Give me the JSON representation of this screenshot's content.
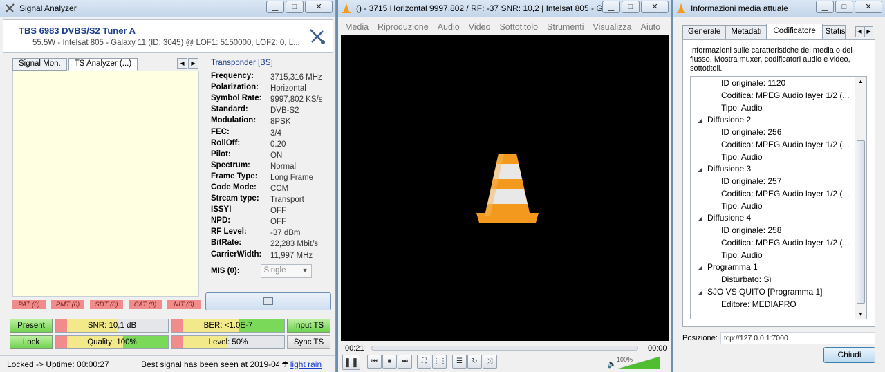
{
  "signal_analyzer": {
    "title": "Signal Analyzer",
    "tuner": "TBS 6983 DVBS/S2 Tuner A",
    "satellite": "55.5W - Intelsat 805 - Galaxy 11 (ID: 3045) @ LOF1: 5150000, LOF2: 0, L...",
    "tabs": [
      "Signal Mon.",
      "TS Analyzer (...)"
    ],
    "transponder_title": "Transponder [BS]",
    "params": [
      {
        "k": "Frequency:",
        "v": "3715,316 MHz"
      },
      {
        "k": "Polarization:",
        "v": "Horizontal"
      },
      {
        "k": "Symbol Rate:",
        "v": "9997,802 KS/s"
      },
      {
        "k": "Standard:",
        "v": "DVB-S2"
      },
      {
        "k": "Modulation:",
        "v": "8PSK"
      },
      {
        "k": "FEC:",
        "v": "3/4"
      },
      {
        "k": "RollOff:",
        "v": "0.20"
      },
      {
        "k": "Pilot:",
        "v": "ON"
      },
      {
        "k": "Spectrum:",
        "v": "Normal"
      },
      {
        "k": "Frame Type:",
        "v": "Long Frame"
      },
      {
        "k": "Code Mode:",
        "v": "CCM"
      },
      {
        "k": "Stream type:",
        "v": "Transport"
      },
      {
        "k": "ISSYI",
        "v": "OFF"
      },
      {
        "k": "NPD:",
        "v": "OFF"
      },
      {
        "k": "RF Level:",
        "v": "-37 dBm"
      },
      {
        "k": "BitRate:",
        "v": "22,283 Mbit/s"
      },
      {
        "k": "CarrierWidth:",
        "v": "11,997 MHz"
      }
    ],
    "mis_label": "MIS (0):",
    "mis_value": "Single",
    "tables": [
      "PAT (0)",
      "PMT (0)",
      "SDT (0)",
      "CAT (0)",
      "NIT (0)"
    ],
    "leds": {
      "present": "Present",
      "lock": "Lock",
      "input_ts": "Input TS",
      "sync_ts": "Sync TS"
    },
    "meters": {
      "snr": {
        "label": "SNR: 10,1 dB",
        "level": 0.55
      },
      "quality": {
        "label": "Quality: 100%",
        "level": 1.0
      },
      "ber": {
        "label": "BER: <1.0E-7",
        "level": 1.0
      },
      "rf_level": {
        "label": "Level: 50%",
        "level": 0.5
      }
    },
    "status_uptime": "Locked -> Uptime: 00:00:27",
    "status_best": "Best signal has been seen at 2019-04",
    "status_weather": "light rain"
  },
  "vlc": {
    "title": "() - 3715 Horizontal 9997,802 / RF: -37 SNR: 10,2 | Intelsat 805 - G...",
    "menu": [
      "Media",
      "Riproduzione",
      "Audio",
      "Video",
      "Sottotitolo",
      "Strumenti",
      "Visualizza",
      "Aiuto"
    ],
    "elapsed": "00:21",
    "remaining": "00:00",
    "volume": "100%"
  },
  "media_info": {
    "title": "Informazioni media attuale",
    "tabs": [
      "Generale",
      "Metadati",
      "Codificatore",
      "Statist"
    ],
    "description": "Informazioni sulle caratteristiche del media o del flusso. Mostra muxer, codificatori audio e video, sottotitoli.",
    "tree": [
      {
        "level": 1,
        "text": "ID originale: 1120"
      },
      {
        "level": 1,
        "text": "Codifica: MPEG Audio layer 1/2 (..."
      },
      {
        "level": 1,
        "text": "Tipo: Audio"
      },
      {
        "level": 0,
        "text": "Diffusione 2"
      },
      {
        "level": 1,
        "text": "ID originale: 256"
      },
      {
        "level": 1,
        "text": "Codifica: MPEG Audio layer 1/2 (..."
      },
      {
        "level": 1,
        "text": "Tipo: Audio"
      },
      {
        "level": 0,
        "text": "Diffusione 3"
      },
      {
        "level": 1,
        "text": "ID originale: 257"
      },
      {
        "level": 1,
        "text": "Codifica: MPEG Audio layer 1/2 (..."
      },
      {
        "level": 1,
        "text": "Tipo: Audio"
      },
      {
        "level": 0,
        "text": "Diffusione 4"
      },
      {
        "level": 1,
        "text": "ID originale: 258"
      },
      {
        "level": 1,
        "text": "Codifica: MPEG Audio layer 1/2 (..."
      },
      {
        "level": 1,
        "text": "Tipo: Audio"
      },
      {
        "level": 0,
        "text": "Programma 1"
      },
      {
        "level": 1,
        "text": "Disturbato: Sì"
      },
      {
        "level": 0,
        "text": "SJO VS QUITO [Programma 1]"
      },
      {
        "level": 1,
        "text": "Editore: MEDIAPRO"
      }
    ],
    "position_label": "Posizione:",
    "position_value": "tcp://127.0.0.1:7000",
    "close_label": "Chiudi"
  },
  "colors": {
    "led_green": "#6fd24f",
    "meter_red": "#f08c8c",
    "meter_yellow": "#f2ea8a",
    "meter_green": "#7bd95a",
    "vlc_orange": "#f39a1e"
  }
}
